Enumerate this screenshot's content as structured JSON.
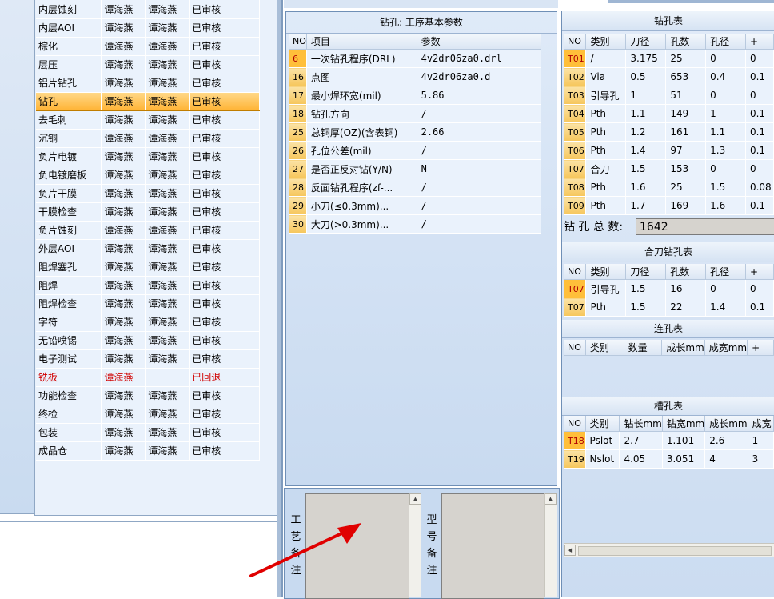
{
  "process_list": [
    {
      "name": "内层蚀刻",
      "a": "谭海燕",
      "b": "谭海燕",
      "status": "已审核"
    },
    {
      "name": "内层AOI",
      "a": "谭海燕",
      "b": "谭海燕",
      "status": "已审核"
    },
    {
      "name": "棕化",
      "a": "谭海燕",
      "b": "谭海燕",
      "status": "已审核"
    },
    {
      "name": "层压",
      "a": "谭海燕",
      "b": "谭海燕",
      "status": "已审核"
    },
    {
      "name": "铝片钻孔",
      "a": "谭海燕",
      "b": "谭海燕",
      "status": "已审核"
    },
    {
      "name": "钻孔",
      "a": "谭海燕",
      "b": "谭海燕",
      "status": "已审核"
    },
    {
      "name": "去毛刺",
      "a": "谭海燕",
      "b": "谭海燕",
      "status": "已审核"
    },
    {
      "name": "沉铜",
      "a": "谭海燕",
      "b": "谭海燕",
      "status": "已审核"
    },
    {
      "name": "负片电镀",
      "a": "谭海燕",
      "b": "谭海燕",
      "status": "已审核"
    },
    {
      "name": "负电镀磨板",
      "a": "谭海燕",
      "b": "谭海燕",
      "status": "已审核"
    },
    {
      "name": "负片干膜",
      "a": "谭海燕",
      "b": "谭海燕",
      "status": "已审核"
    },
    {
      "name": "干膜检查",
      "a": "谭海燕",
      "b": "谭海燕",
      "status": "已审核"
    },
    {
      "name": "负片蚀刻",
      "a": "谭海燕",
      "b": "谭海燕",
      "status": "已审核"
    },
    {
      "name": "外层AOI",
      "a": "谭海燕",
      "b": "谭海燕",
      "status": "已审核"
    },
    {
      "name": "阻焊塞孔",
      "a": "谭海燕",
      "b": "谭海燕",
      "status": "已审核"
    },
    {
      "name": "阻焊",
      "a": "谭海燕",
      "b": "谭海燕",
      "status": "已审核"
    },
    {
      "name": "阻焊检查",
      "a": "谭海燕",
      "b": "谭海燕",
      "status": "已审核"
    },
    {
      "name": "字符",
      "a": "谭海燕",
      "b": "谭海燕",
      "status": "已审核"
    },
    {
      "name": "无铅喷锡",
      "a": "谭海燕",
      "b": "谭海燕",
      "status": "已审核"
    },
    {
      "name": "电子测试",
      "a": "谭海燕",
      "b": "谭海燕",
      "status": "已审核"
    },
    {
      "name": "铣板",
      "a": "谭海燕",
      "b": "",
      "status": "已回退"
    },
    {
      "name": "功能检查",
      "a": "谭海燕",
      "b": "谭海燕",
      "status": "已审核"
    },
    {
      "name": "终检",
      "a": "谭海燕",
      "b": "谭海燕",
      "status": "已审核"
    },
    {
      "name": "包装",
      "a": "谭海燕",
      "b": "谭海燕",
      "status": "已审核"
    },
    {
      "name": "成品仓",
      "a": "谭海燕",
      "b": "谭海燕",
      "status": "已审核"
    }
  ],
  "params": {
    "title": "钻孔: 工序基本参数",
    "headers": {
      "no": "NO",
      "item": "项目",
      "value": "参数"
    },
    "rows": [
      {
        "no": "6",
        "item": "一次钻孔程序(DRL)",
        "value": "4v2dr06za0.drl"
      },
      {
        "no": "16",
        "item": "点图",
        "value": "4v2dr06za0.d"
      },
      {
        "no": "17",
        "item": "最小焊环宽(mil)",
        "value": "5.86"
      },
      {
        "no": "18",
        "item": "钻孔方向",
        "value": "/"
      },
      {
        "no": "25",
        "item": "总铜厚(OZ)(含表铜)",
        "value": "2.66"
      },
      {
        "no": "26",
        "item": "孔位公差(mil)",
        "value": "/"
      },
      {
        "no": "27",
        "item": "是否正反对钻(Y/N)",
        "value": "N"
      },
      {
        "no": "28",
        "item": "反面钻孔程序(zf-...",
        "value": "/"
      },
      {
        "no": "29",
        "item": "小刀(≤0.3mm)...",
        "value": "/"
      },
      {
        "no": "30",
        "item": "大刀(>0.3mm)...",
        "value": "/"
      }
    ]
  },
  "notes": {
    "process_label": "工艺备注",
    "model_label": "型号备注"
  },
  "drill_table": {
    "title": "钻孔表",
    "headers": [
      "NO",
      "类别",
      "刀径",
      "孔数",
      "孔径",
      "+"
    ],
    "rows": [
      [
        "T01",
        "/",
        "3.175",
        "25",
        "0",
        "0"
      ],
      [
        "T02",
        "Via",
        "0.5",
        "653",
        "0.4",
        "0.1"
      ],
      [
        "T03",
        "引导孔",
        "1",
        "51",
        "0",
        "0"
      ],
      [
        "T04",
        "Pth",
        "1.1",
        "149",
        "1",
        "0.1"
      ],
      [
        "T05",
        "Pth",
        "1.2",
        "161",
        "1.1",
        "0.1"
      ],
      [
        "T06",
        "Pth",
        "1.4",
        "97",
        "1.3",
        "0.1"
      ],
      [
        "T07",
        "合刀",
        "1.5",
        "153",
        "0",
        "0"
      ],
      [
        "T08",
        "Pth",
        "1.6",
        "25",
        "1.5",
        "0.08"
      ],
      [
        "T09",
        "Pth",
        "1.7",
        "169",
        "1.6",
        "0.1"
      ]
    ],
    "total_label": "钻 孔 总 数:",
    "total_value": "1642"
  },
  "combo_table": {
    "title": "合刀钻孔表",
    "headers": [
      "NO",
      "类别",
      "刀径",
      "孔数",
      "孔径",
      "+"
    ],
    "rows": [
      [
        "T07",
        "引导孔",
        "1.5",
        "16",
        "0",
        "0"
      ],
      [
        "T07",
        "Pth",
        "1.5",
        "22",
        "1.4",
        "0.1"
      ]
    ]
  },
  "link_table": {
    "title": "连孔表",
    "headers": [
      "NO",
      "类别",
      "数量",
      "成长mm",
      "成宽mm",
      "+"
    ]
  },
  "slot_table": {
    "title": "槽孔表",
    "headers": [
      "NO",
      "类别",
      "钻长mm",
      "钻宽mm",
      "成长mm",
      "成宽"
    ],
    "rows": [
      [
        "T18",
        "Pslot",
        "2.7",
        "1.101",
        "2.6",
        "1"
      ],
      [
        "T19",
        "Nslot",
        "4.05",
        "3.051",
        "4",
        "3"
      ]
    ]
  },
  "colors": {
    "selected_row": "#ffb437",
    "rejected": "#d00000",
    "arrow": "#e00000"
  }
}
